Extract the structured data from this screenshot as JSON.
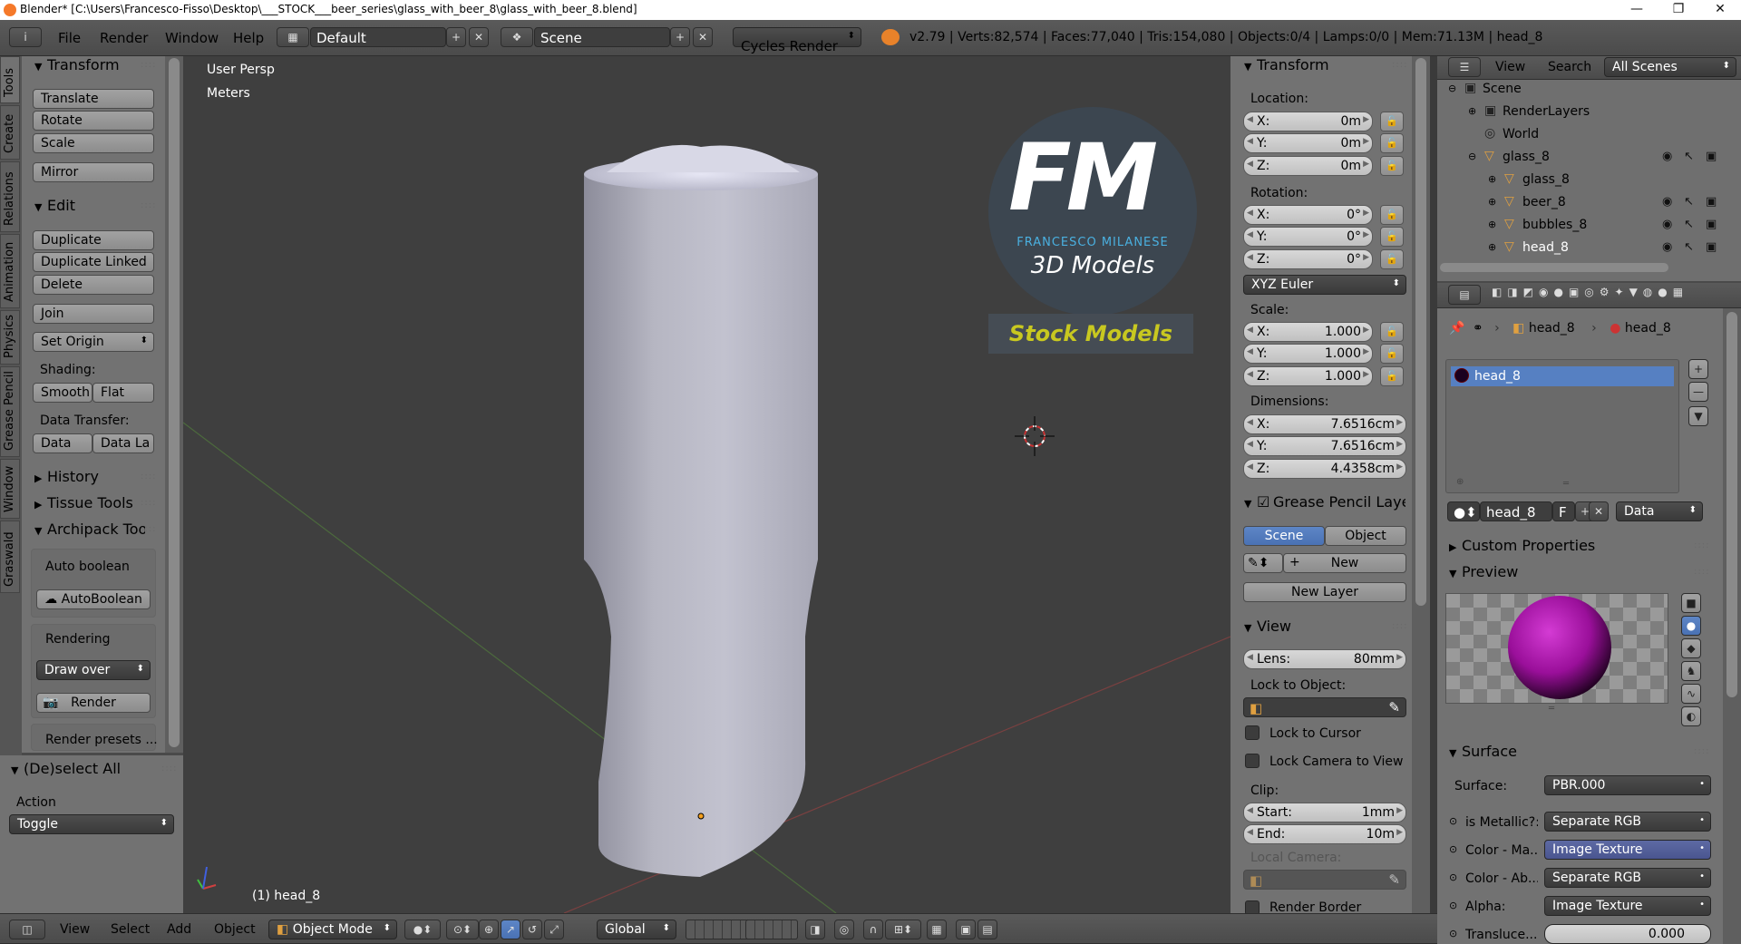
{
  "title_bar": {
    "title": "Blender* [C:\\Users\\Francesco-Fisso\\Desktop\\___STOCK___beer_series\\glass_with_beer_8\\glass_with_beer_8.blend]"
  },
  "menu": {
    "info_icon": "i",
    "file": "File",
    "render": "Render",
    "window": "Window",
    "help": "Help"
  },
  "header": {
    "layout": "Default",
    "scene": "Scene",
    "engine": "Cycles Render",
    "stats": "v2.79 | Verts:82,574 | Faces:77,040 | Tris:154,080 | Objects:0/4 | Lamps:0/0 | Mem:71.13M | head_8"
  },
  "tabs": [
    "Tools",
    "Create",
    "Relations",
    "Animation",
    "Physics",
    "Grease Pencil",
    "Window",
    "Graswald"
  ],
  "tools": {
    "transform_title": "Transform",
    "translate": "Translate",
    "rotate": "Rotate",
    "scale": "Scale",
    "mirror": "Mirror",
    "edit_title": "Edit",
    "duplicate": "Duplicate",
    "duplicate_linked": "Duplicate Linked",
    "delete": "Delete",
    "join": "Join",
    "set_origin": "Set Origin",
    "shading_label": "Shading:",
    "smooth": "Smooth",
    "flat": "Flat",
    "data_transfer_label": "Data Transfer:",
    "data": "Data",
    "data_la": "Data La",
    "history": "History",
    "tissue_tools": "Tissue Tools",
    "archipack": "Archipack Tools",
    "auto_boolean_label": "Auto boolean",
    "auto_boolean_btn": "AutoBoolean",
    "rendering_label": "Rendering",
    "draw_over": "Draw over",
    "render_btn": "Render",
    "render_presets": "Render presets ..."
  },
  "operator": {
    "title": "(De)select All",
    "action_label": "Action",
    "action_value": "Toggle"
  },
  "viewport": {
    "view_name": "User Persp",
    "units": "Meters",
    "object_label": "(1) head_8"
  },
  "logo": {
    "letters": "FM",
    "name": "FRANCESCO MILANESE",
    "sub": "3D Models",
    "badge": "Stock Models"
  },
  "n_panel": {
    "transform_title": "Transform",
    "location_label": "Location:",
    "loc": [
      {
        "axis": "X:",
        "value": "0m"
      },
      {
        "axis": "Y:",
        "value": "0m"
      },
      {
        "axis": "Z:",
        "value": "0m"
      }
    ],
    "rotation_label": "Rotation:",
    "rot": [
      {
        "axis": "X:",
        "value": "0°"
      },
      {
        "axis": "Y:",
        "value": "0°"
      },
      {
        "axis": "Z:",
        "value": "0°"
      }
    ],
    "rot_mode": "XYZ Euler",
    "scale_label": "Scale:",
    "scl": [
      {
        "axis": "X:",
        "value": "1.000"
      },
      {
        "axis": "Y:",
        "value": "1.000"
      },
      {
        "axis": "Z:",
        "value": "1.000"
      }
    ],
    "dimensions_label": "Dimensions:",
    "dim": [
      {
        "axis": "X:",
        "value": "7.6516cm"
      },
      {
        "axis": "Y:",
        "value": "7.6516cm"
      },
      {
        "axis": "Z:",
        "value": "4.4358cm"
      }
    ],
    "gp_title": "Grease Pencil Layer",
    "gp_scene": "Scene",
    "gp_object": "Object",
    "gp_new": "New",
    "gp_new_layer": "New Layer",
    "view_title": "View",
    "lens_label": "Lens:",
    "lens_value": "80mm",
    "lock_obj_label": "Lock to Object:",
    "lock_cursor": "Lock to Cursor",
    "lock_camera": "Lock Camera to View",
    "clip_label": "Clip:",
    "clip_start_label": "Start:",
    "clip_start": "1mm",
    "clip_end_label": "End:",
    "clip_end": "10m",
    "local_camera": "Local Camera:",
    "render_border": "Render Border"
  },
  "outliner": {
    "view": "View",
    "search": "Search",
    "scenes": "All Scenes",
    "rows": [
      {
        "name": "Scene",
        "indent": 0
      },
      {
        "name": "RenderLayers",
        "indent": 1
      },
      {
        "name": "World",
        "indent": 1
      },
      {
        "name": "glass_8",
        "indent": 1
      },
      {
        "name": "glass_8",
        "indent": 2
      },
      {
        "name": "beer_8",
        "indent": 2
      },
      {
        "name": "bubbles_8",
        "indent": 2
      },
      {
        "name": "head_8",
        "indent": 2
      }
    ]
  },
  "properties": {
    "crumb_obj": "head_8",
    "crumb_mat": "head_8",
    "slot_item": "head_8",
    "mat_name": "head_8",
    "mat_f": "F",
    "link_mode": "Data",
    "custom_props": "Custom Properties",
    "preview": "Preview",
    "surface_title": "Surface",
    "surface_label": "Surface:",
    "surface_value": "PBR.000",
    "inputs": [
      {
        "label": "is Metallic?:",
        "value": "Separate RGB"
      },
      {
        "label": "Color - Ma...",
        "value": "Image Texture"
      },
      {
        "label": "Color - Ab...",
        "value": "Separate RGB"
      },
      {
        "label": "Alpha:",
        "value": "Image Texture"
      },
      {
        "label": "Transluce...",
        "value": "0.000"
      }
    ]
  },
  "bottom": {
    "view": "View",
    "select": "Select",
    "add": "Add",
    "object": "Object",
    "mode": "Object Mode",
    "orientation": "Global"
  }
}
